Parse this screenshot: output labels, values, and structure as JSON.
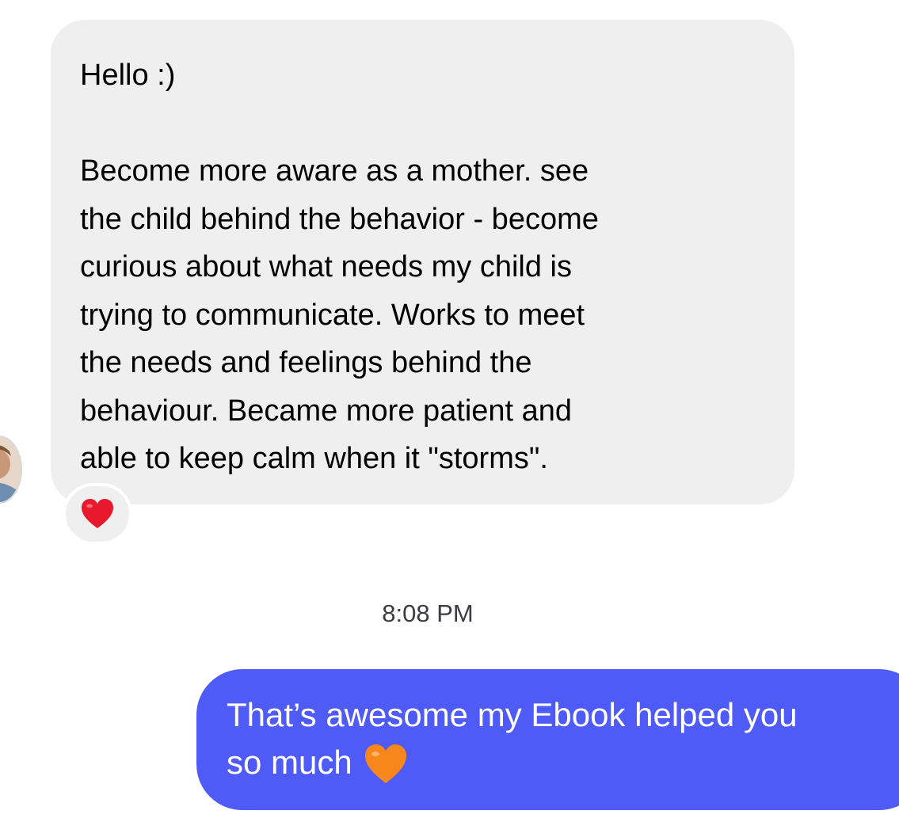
{
  "conversation": {
    "incoming_message": {
      "text": "Hello :)\n\nBecome more aware as a mother. see\nthe child behind the behavior - become\ncurious about what needs my child is\ntrying to communicate. Works to meet\nthe needs and feelings behind the\nbehaviour. Became more patient and\nable to keep calm when it \"storms\".",
      "reaction": "❤️",
      "reaction_icon": "red-heart-icon",
      "reaction_color": "#e8192c"
    },
    "timestamp": "8:08 PM",
    "outgoing_message": {
      "line1": "That’s awesome my Ebook helped you",
      "line2": "so much",
      "emoji": "🧡",
      "emoji_icon": "orange-heart-icon",
      "emoji_color": "#f7861b",
      "bubble_color": "#4f5bf7"
    }
  }
}
